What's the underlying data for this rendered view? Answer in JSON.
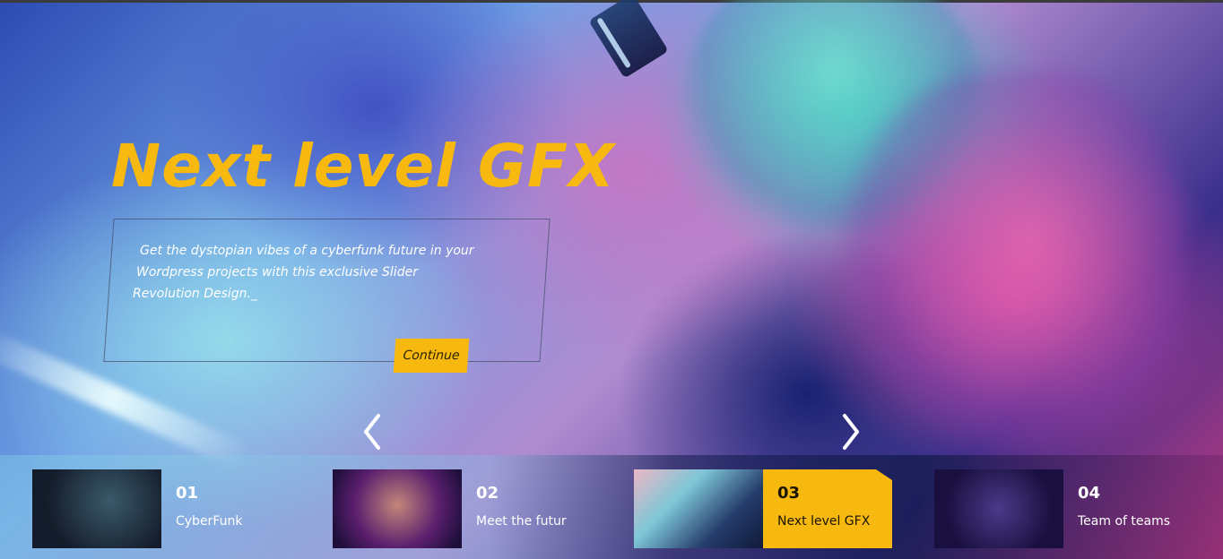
{
  "hero": {
    "title": "Next level GFX",
    "description_lines": [
      "Get the dystopian vibes of a cyberfunk future in your",
      "Wordpress projects with this exclusive Slider",
      "Revolution Design._"
    ],
    "continue_label": "Continue"
  },
  "navigation": {
    "prev_icon": "chevron-left-icon",
    "next_icon": "chevron-right-icon"
  },
  "thumbnails": [
    {
      "number": "01",
      "label": "CyberFunk",
      "active": false
    },
    {
      "number": "02",
      "label": "Meet the futur",
      "active": false
    },
    {
      "number": "03",
      "label": "Next level GFX",
      "active": true
    },
    {
      "number": "04",
      "label": "Team of teams",
      "active": false
    }
  ],
  "colors": {
    "accent": "#f7b90f",
    "text": "#ffffff"
  }
}
